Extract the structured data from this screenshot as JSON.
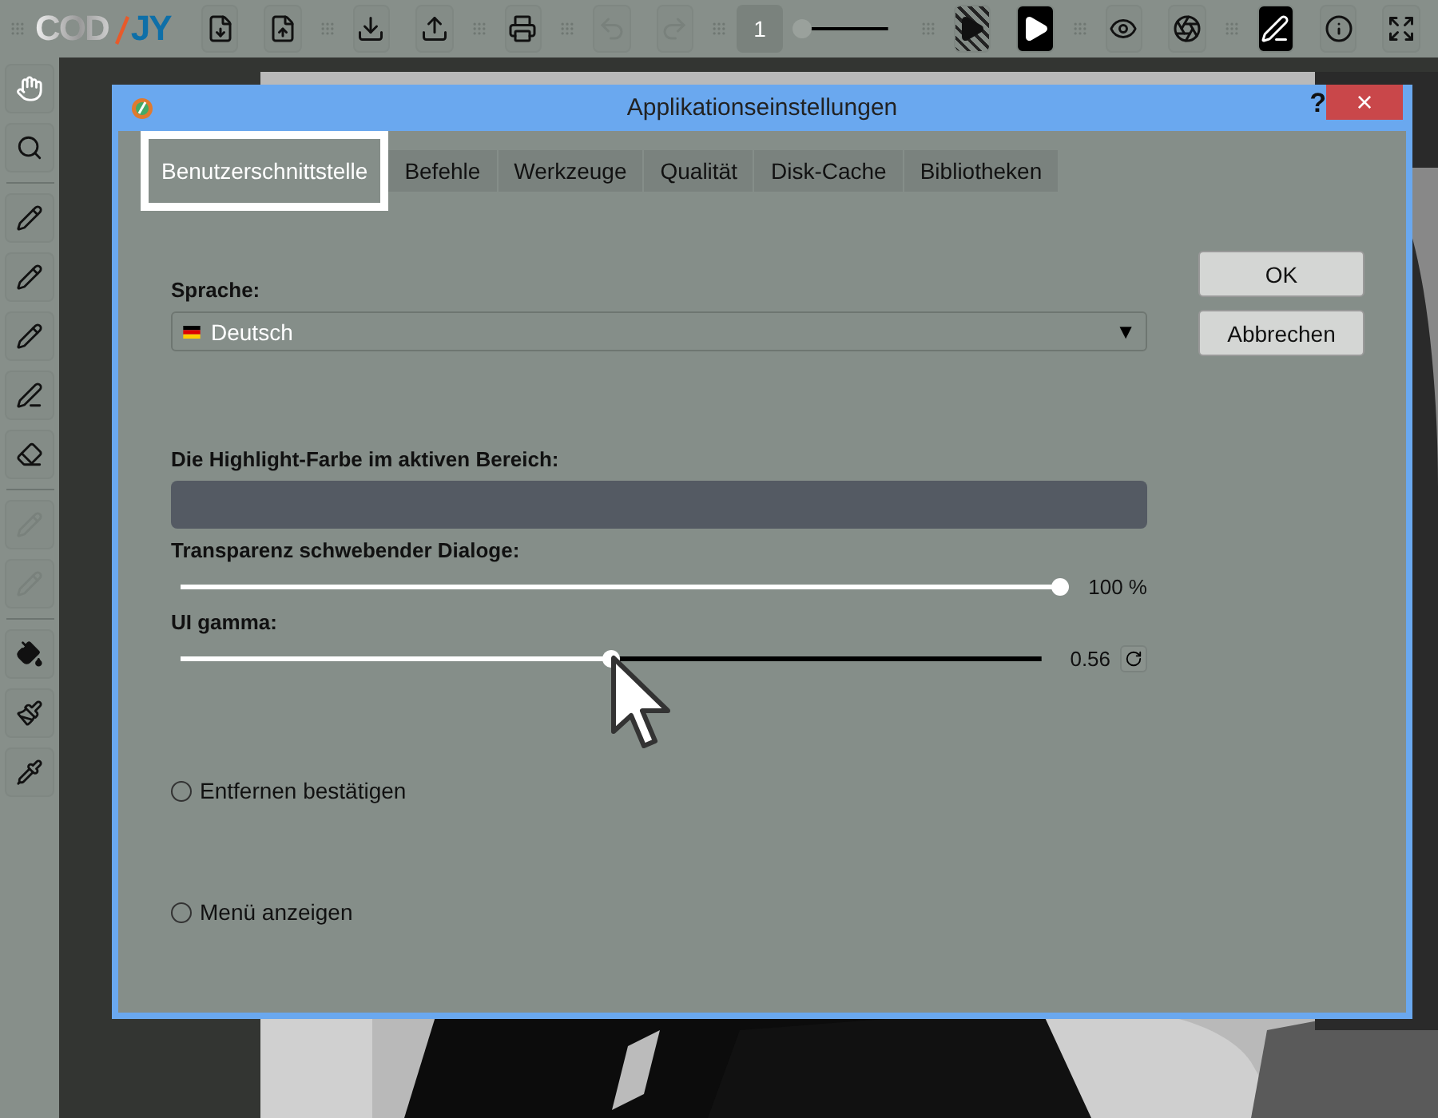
{
  "toolbar": {
    "logo": {
      "start": "COD",
      "end": "JY"
    },
    "items": [
      {
        "kind": "grip"
      },
      {
        "kind": "logo"
      },
      {
        "kind": "button",
        "disabled": false,
        "active": false
      },
      {
        "kind": "button",
        "disabled": false,
        "active": false
      },
      {
        "kind": "grip"
      },
      {
        "kind": "button",
        "disabled": false,
        "active": false
      },
      {
        "kind": "button",
        "disabled": false,
        "active": false
      },
      {
        "kind": "grip"
      },
      {
        "kind": "button",
        "disabled": false,
        "active": false
      },
      {
        "kind": "grip"
      },
      {
        "kind": "button",
        "disabled": true,
        "active": false
      },
      {
        "kind": "button",
        "disabled": true,
        "active": false
      },
      {
        "kind": "grip"
      },
      {
        "kind": "page",
        "value": "1"
      },
      {
        "kind": "slider",
        "level": 0
      },
      {
        "kind": "grip"
      },
      {
        "kind": "button",
        "disabled": false,
        "active": false,
        "striped": true
      },
      {
        "kind": "button",
        "disabled": false,
        "active": true
      },
      {
        "kind": "grip"
      },
      {
        "kind": "button",
        "disabled": false,
        "active": false
      },
      {
        "kind": "button",
        "disabled": false,
        "active": false
      },
      {
        "kind": "grip"
      },
      {
        "kind": "button",
        "disabled": false,
        "active": true
      },
      {
        "kind": "button",
        "disabled": false,
        "active": false
      },
      {
        "kind": "button",
        "disabled": false,
        "active": false
      }
    ]
  },
  "tools": [
    {
      "kind": "tool",
      "selected": true,
      "disabled": false
    },
    {
      "kind": "tool",
      "selected": false,
      "disabled": false
    },
    {
      "kind": "divider"
    },
    {
      "kind": "tool",
      "selected": false,
      "disabled": false
    },
    {
      "kind": "tool",
      "selected": false,
      "disabled": false
    },
    {
      "kind": "tool",
      "selected": false,
      "disabled": false
    },
    {
      "kind": "tool",
      "selected": false,
      "disabled": false
    },
    {
      "kind": "tool",
      "selected": false,
      "disabled": false
    },
    {
      "kind": "divider"
    },
    {
      "kind": "tool",
      "selected": false,
      "disabled": true
    },
    {
      "kind": "tool",
      "selected": false,
      "disabled": true
    },
    {
      "kind": "divider"
    },
    {
      "kind": "tool",
      "selected": false,
      "disabled": false
    },
    {
      "kind": "tool",
      "selected": false,
      "disabled": false
    },
    {
      "kind": "tool",
      "selected": false,
      "disabled": false
    }
  ],
  "dialog": {
    "title": "Applikationseinstellungen",
    "help": "?",
    "close": "×",
    "tabs": [
      {
        "label": "Benutzerschnittstelle",
        "selected": true
      },
      {
        "label": "Befehle",
        "selected": false
      },
      {
        "label": "Werkzeuge",
        "selected": false
      },
      {
        "label": "Qualität",
        "selected": false
      },
      {
        "label": "Disk-Cache",
        "selected": false
      },
      {
        "label": "Bibliotheken",
        "selected": false
      }
    ],
    "buttons": [
      "OK",
      "Abbrechen"
    ],
    "language": {
      "label": "Sprache:",
      "value": "Deutsch",
      "arrow": "▼"
    },
    "highlight": {
      "label": "Die Highlight-Farbe im aktiven Bereich:",
      "color": "#545a63"
    },
    "sliders": [
      {
        "label": "Transparenz schwebender Dialoge:",
        "level": 1,
        "reading": "100 %",
        "reset": false
      },
      {
        "label": "UI gamma:",
        "level": 0.5,
        "reading": "0.56",
        "reset": true
      }
    ],
    "checkboxes": [
      {
        "label": "Entfernen bestätigen",
        "checked": false
      },
      {
        "label": "Menü anzeigen",
        "checked": false
      }
    ]
  }
}
